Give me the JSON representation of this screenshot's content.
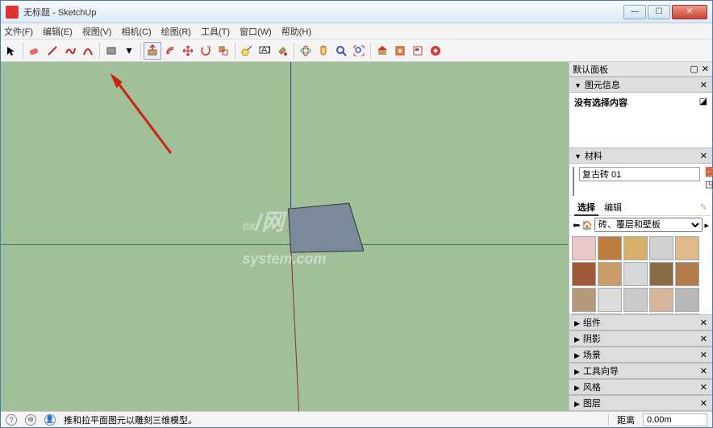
{
  "window": {
    "title": "无标题 - SketchUp"
  },
  "menu": [
    "文件(F)",
    "编辑(E)",
    "视图(V)",
    "相机(C)",
    "绘图(R)",
    "工具(T)",
    "窗口(W)",
    "帮助(H)"
  ],
  "rightpane": {
    "header": "默认面板",
    "entity_info": {
      "title": "图元信息",
      "body": "没有选择内容"
    },
    "materials": {
      "title": "材料",
      "name": "复古砖 01",
      "tabs": {
        "select": "选择",
        "edit": "编辑"
      },
      "category": "砖、覆层和壁板"
    },
    "collapsed": [
      "组件",
      "阴影",
      "场景",
      "工具向导",
      "风格",
      "图层"
    ]
  },
  "status": {
    "hint": "推和拉平面图元以雕刻三维模型。",
    "distance_label": "距离",
    "distance_value": "0.00m"
  },
  "watermark": {
    "main": "GX",
    "sub": "system.com",
    "mid": "/网"
  },
  "mat_swatches": [
    "#e9c7c7",
    "#bf7a3e",
    "#d6b06a",
    "#cfcfcf",
    "#e0b98a",
    "#a05a3a",
    "#c99b6a",
    "#d8d8d8",
    "#8a6b48",
    "#b07a4a",
    "#b49a7a",
    "#dcdcdc",
    "#c9c9c9",
    "#d6b49a",
    "#b8b8b8",
    "#e6e6e6",
    "#c9b26a",
    "#d0c49a",
    "#d6b49a",
    "#bdbdbd"
  ]
}
